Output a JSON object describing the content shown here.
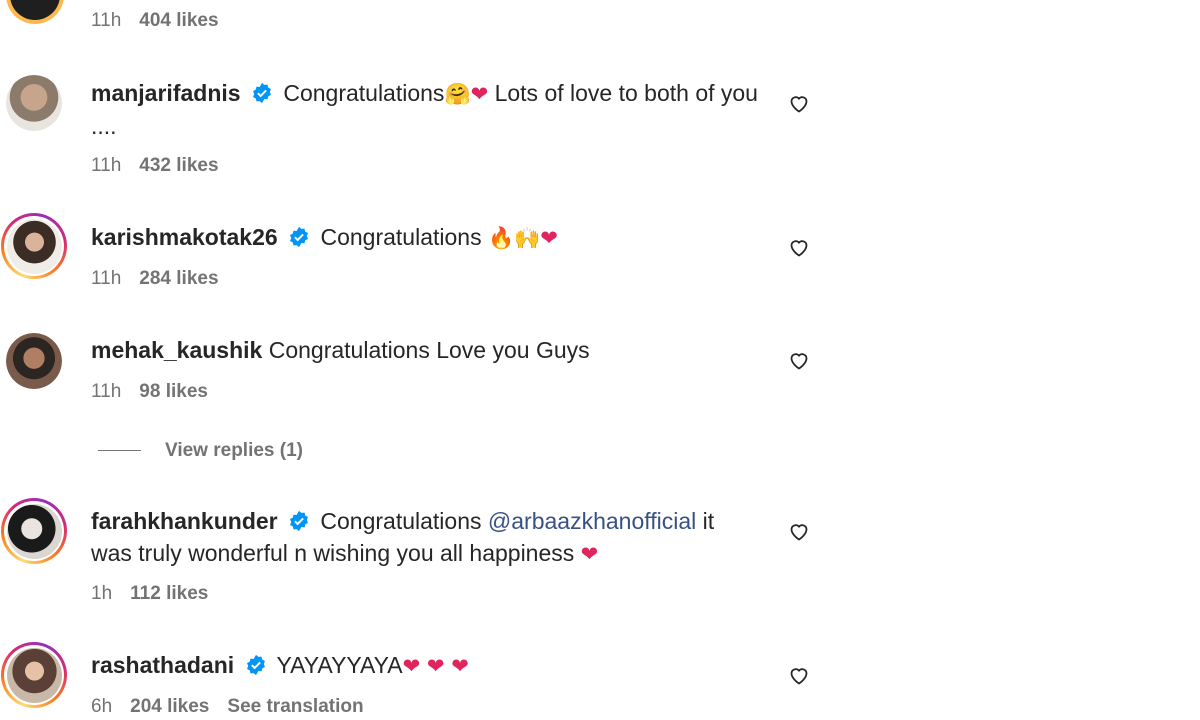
{
  "top_meta": {
    "time": "11h",
    "likes": "404 likes"
  },
  "comments": [
    {
      "username": "manjarifadnis",
      "verified": true,
      "text_before": "Congratulations",
      "emojis_1": "🤗❤",
      "text_after": " Lots of love to both of you ....",
      "time": "11h",
      "likes": "432 likes"
    },
    {
      "username": "karishmakotak26",
      "verified": true,
      "text_before": "Congratulations ",
      "emojis_1": "🔥🙌❤",
      "text_after": "",
      "time": "11h",
      "likes": "284 likes"
    },
    {
      "username": "mehak_kaushik",
      "verified": false,
      "text_before": "Congratulations Love you Guys",
      "time": "11h",
      "likes": "98 likes"
    },
    {
      "username": "farahkhankunder",
      "verified": true,
      "text_before": "Congratulations ",
      "mention": "@arbaazkhanofficial",
      "text_after": " it was truly wonderful n wishing you all happiness ",
      "emojis_1": "❤",
      "time": "1h",
      "likes": "112 likes"
    },
    {
      "username": "rashathadani",
      "verified": true,
      "text_before": "YAYAYYAYA",
      "emojis_1": "❤ ❤ ❤",
      "time": "6h",
      "likes": "204 likes",
      "translate": "See translation"
    }
  ],
  "view_replies": "View replies (1)",
  "colors": {
    "verified": "#0095f6",
    "mention": "#385185",
    "meta": "#737373",
    "heart_emoji": "#e0245e"
  },
  "icons": {
    "like": "heart-outline-icon",
    "verified": "verified-badge-icon"
  }
}
